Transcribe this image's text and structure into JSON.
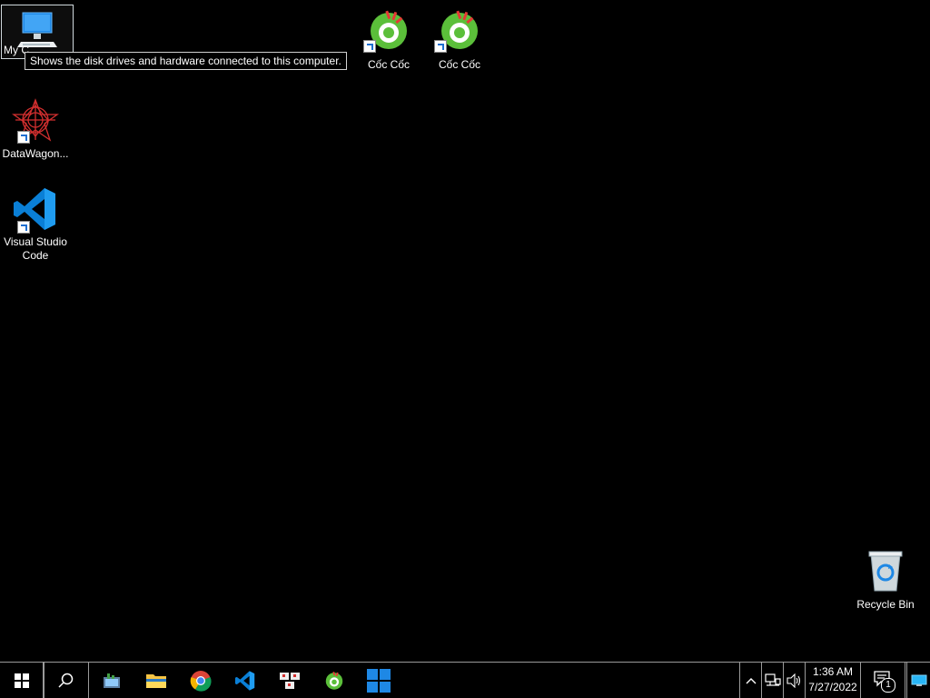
{
  "desktop": {
    "icons": [
      {
        "label": "My C",
        "name": "my-computer"
      },
      {
        "label": "Cốc Cốc",
        "name": "coccoc-1"
      },
      {
        "label": "Cốc Cốc",
        "name": "coccoc-2"
      },
      {
        "label": "DataWagon...",
        "name": "datawagon"
      },
      {
        "label": "Visual Studio Code",
        "name": "vscode"
      },
      {
        "label": "Recycle Bin",
        "name": "recycle-bin"
      }
    ],
    "tooltip": "Shows the disk drives and hardware connected to this computer."
  },
  "taskbar": {
    "clock": {
      "time": "1:36 AM",
      "date": "7/27/2022"
    },
    "notification_count": "1"
  },
  "colors": {
    "background": "#000000",
    "accent": "#0078d7",
    "coccoc_green": "#5bbf3a"
  }
}
